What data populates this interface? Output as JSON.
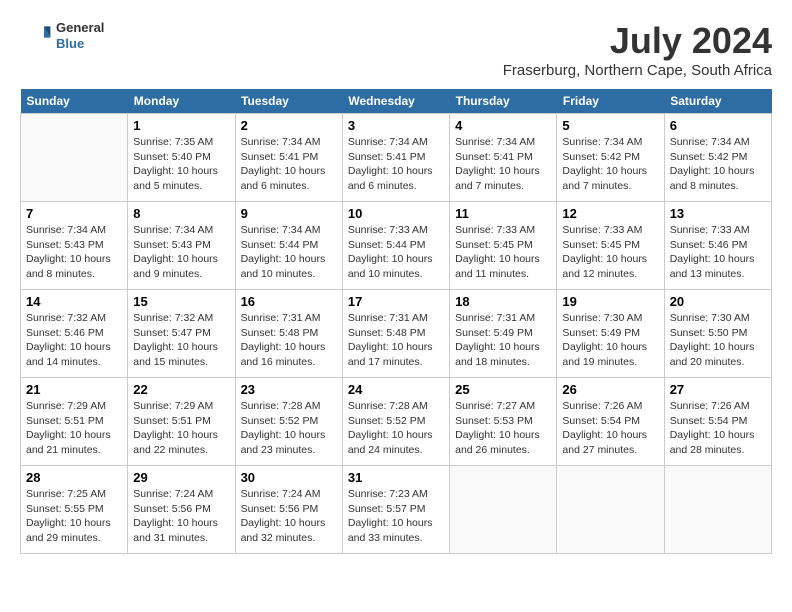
{
  "logo": {
    "general": "General",
    "blue": "Blue"
  },
  "title": "July 2024",
  "location": "Fraserburg, Northern Cape, South Africa",
  "headers": [
    "Sunday",
    "Monday",
    "Tuesday",
    "Wednesday",
    "Thursday",
    "Friday",
    "Saturday"
  ],
  "weeks": [
    [
      {
        "day": "",
        "sunrise": "",
        "sunset": "",
        "daylight": ""
      },
      {
        "day": "1",
        "sunrise": "Sunrise: 7:35 AM",
        "sunset": "Sunset: 5:40 PM",
        "daylight": "Daylight: 10 hours and 5 minutes."
      },
      {
        "day": "2",
        "sunrise": "Sunrise: 7:34 AM",
        "sunset": "Sunset: 5:41 PM",
        "daylight": "Daylight: 10 hours and 6 minutes."
      },
      {
        "day": "3",
        "sunrise": "Sunrise: 7:34 AM",
        "sunset": "Sunset: 5:41 PM",
        "daylight": "Daylight: 10 hours and 6 minutes."
      },
      {
        "day": "4",
        "sunrise": "Sunrise: 7:34 AM",
        "sunset": "Sunset: 5:41 PM",
        "daylight": "Daylight: 10 hours and 7 minutes."
      },
      {
        "day": "5",
        "sunrise": "Sunrise: 7:34 AM",
        "sunset": "Sunset: 5:42 PM",
        "daylight": "Daylight: 10 hours and 7 minutes."
      },
      {
        "day": "6",
        "sunrise": "Sunrise: 7:34 AM",
        "sunset": "Sunset: 5:42 PM",
        "daylight": "Daylight: 10 hours and 8 minutes."
      }
    ],
    [
      {
        "day": "7",
        "sunrise": "Sunrise: 7:34 AM",
        "sunset": "Sunset: 5:43 PM",
        "daylight": "Daylight: 10 hours and 8 minutes."
      },
      {
        "day": "8",
        "sunrise": "Sunrise: 7:34 AM",
        "sunset": "Sunset: 5:43 PM",
        "daylight": "Daylight: 10 hours and 9 minutes."
      },
      {
        "day": "9",
        "sunrise": "Sunrise: 7:34 AM",
        "sunset": "Sunset: 5:44 PM",
        "daylight": "Daylight: 10 hours and 10 minutes."
      },
      {
        "day": "10",
        "sunrise": "Sunrise: 7:33 AM",
        "sunset": "Sunset: 5:44 PM",
        "daylight": "Daylight: 10 hours and 10 minutes."
      },
      {
        "day": "11",
        "sunrise": "Sunrise: 7:33 AM",
        "sunset": "Sunset: 5:45 PM",
        "daylight": "Daylight: 10 hours and 11 minutes."
      },
      {
        "day": "12",
        "sunrise": "Sunrise: 7:33 AM",
        "sunset": "Sunset: 5:45 PM",
        "daylight": "Daylight: 10 hours and 12 minutes."
      },
      {
        "day": "13",
        "sunrise": "Sunrise: 7:33 AM",
        "sunset": "Sunset: 5:46 PM",
        "daylight": "Daylight: 10 hours and 13 minutes."
      }
    ],
    [
      {
        "day": "14",
        "sunrise": "Sunrise: 7:32 AM",
        "sunset": "Sunset: 5:46 PM",
        "daylight": "Daylight: 10 hours and 14 minutes."
      },
      {
        "day": "15",
        "sunrise": "Sunrise: 7:32 AM",
        "sunset": "Sunset: 5:47 PM",
        "daylight": "Daylight: 10 hours and 15 minutes."
      },
      {
        "day": "16",
        "sunrise": "Sunrise: 7:31 AM",
        "sunset": "Sunset: 5:48 PM",
        "daylight": "Daylight: 10 hours and 16 minutes."
      },
      {
        "day": "17",
        "sunrise": "Sunrise: 7:31 AM",
        "sunset": "Sunset: 5:48 PM",
        "daylight": "Daylight: 10 hours and 17 minutes."
      },
      {
        "day": "18",
        "sunrise": "Sunrise: 7:31 AM",
        "sunset": "Sunset: 5:49 PM",
        "daylight": "Daylight: 10 hours and 18 minutes."
      },
      {
        "day": "19",
        "sunrise": "Sunrise: 7:30 AM",
        "sunset": "Sunset: 5:49 PM",
        "daylight": "Daylight: 10 hours and 19 minutes."
      },
      {
        "day": "20",
        "sunrise": "Sunrise: 7:30 AM",
        "sunset": "Sunset: 5:50 PM",
        "daylight": "Daylight: 10 hours and 20 minutes."
      }
    ],
    [
      {
        "day": "21",
        "sunrise": "Sunrise: 7:29 AM",
        "sunset": "Sunset: 5:51 PM",
        "daylight": "Daylight: 10 hours and 21 minutes."
      },
      {
        "day": "22",
        "sunrise": "Sunrise: 7:29 AM",
        "sunset": "Sunset: 5:51 PM",
        "daylight": "Daylight: 10 hours and 22 minutes."
      },
      {
        "day": "23",
        "sunrise": "Sunrise: 7:28 AM",
        "sunset": "Sunset: 5:52 PM",
        "daylight": "Daylight: 10 hours and 23 minutes."
      },
      {
        "day": "24",
        "sunrise": "Sunrise: 7:28 AM",
        "sunset": "Sunset: 5:52 PM",
        "daylight": "Daylight: 10 hours and 24 minutes."
      },
      {
        "day": "25",
        "sunrise": "Sunrise: 7:27 AM",
        "sunset": "Sunset: 5:53 PM",
        "daylight": "Daylight: 10 hours and 26 minutes."
      },
      {
        "day": "26",
        "sunrise": "Sunrise: 7:26 AM",
        "sunset": "Sunset: 5:54 PM",
        "daylight": "Daylight: 10 hours and 27 minutes."
      },
      {
        "day": "27",
        "sunrise": "Sunrise: 7:26 AM",
        "sunset": "Sunset: 5:54 PM",
        "daylight": "Daylight: 10 hours and 28 minutes."
      }
    ],
    [
      {
        "day": "28",
        "sunrise": "Sunrise: 7:25 AM",
        "sunset": "Sunset: 5:55 PM",
        "daylight": "Daylight: 10 hours and 29 minutes."
      },
      {
        "day": "29",
        "sunrise": "Sunrise: 7:24 AM",
        "sunset": "Sunset: 5:56 PM",
        "daylight": "Daylight: 10 hours and 31 minutes."
      },
      {
        "day": "30",
        "sunrise": "Sunrise: 7:24 AM",
        "sunset": "Sunset: 5:56 PM",
        "daylight": "Daylight: 10 hours and 32 minutes."
      },
      {
        "day": "31",
        "sunrise": "Sunrise: 7:23 AM",
        "sunset": "Sunset: 5:57 PM",
        "daylight": "Daylight: 10 hours and 33 minutes."
      },
      {
        "day": "",
        "sunrise": "",
        "sunset": "",
        "daylight": ""
      },
      {
        "day": "",
        "sunrise": "",
        "sunset": "",
        "daylight": ""
      },
      {
        "day": "",
        "sunrise": "",
        "sunset": "",
        "daylight": ""
      }
    ]
  ]
}
